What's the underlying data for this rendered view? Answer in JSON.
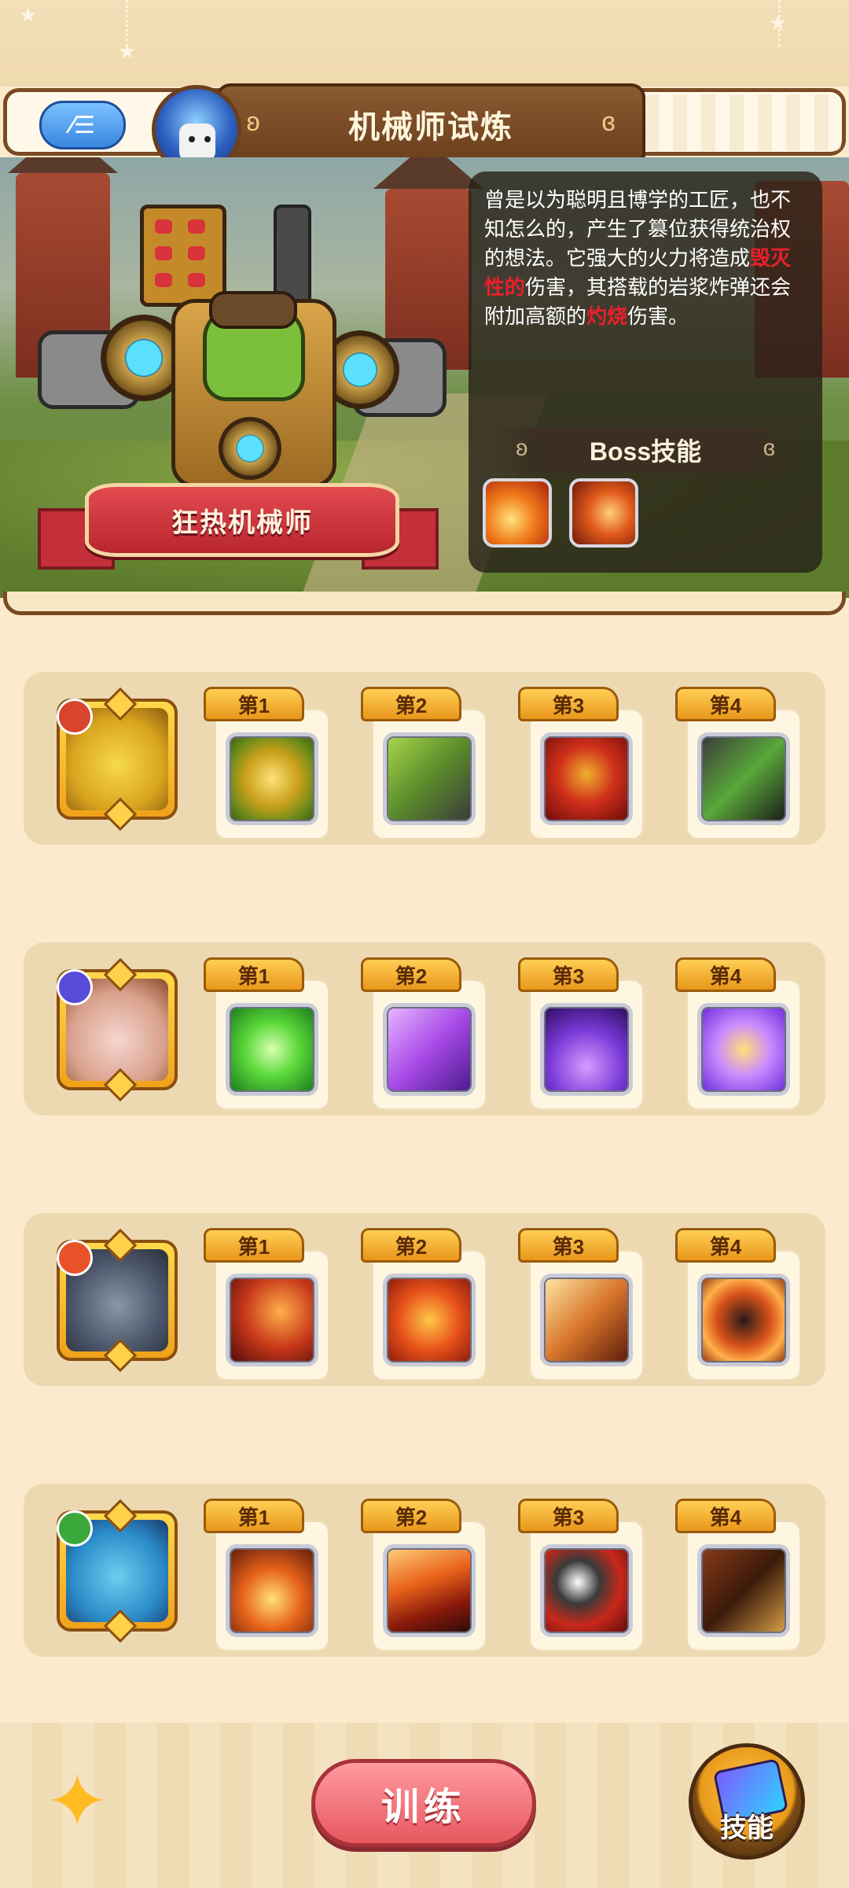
{
  "header": {
    "title": "机械师试炼",
    "back_label": "⁄☰"
  },
  "boss": {
    "name": "狂热机械师",
    "desc_a": "曾是以为聪明且博学的工匠，也不知怎么的，产生了篡位获得统治权的想法。它强大的火力将造成",
    "desc_hl1": "毁灭性的",
    "desc_b": "伤害，其搭载的岩浆炸弹还会附加高额的",
    "desc_hl2": "灼烧",
    "desc_c": "伤害。",
    "skills_title": "Boss技能",
    "skill_icons": [
      "flame-claw-icon",
      "fire-slash-icon"
    ]
  },
  "slot_labels": [
    "第1",
    "第2",
    "第3",
    "第4"
  ],
  "pets": [
    {
      "name": "yellow-pet-icon",
      "element": "fire-element-icon",
      "skills": [
        "golden-shield-icon",
        "thorn-attack-icon",
        "rage-face-icon",
        "dark-knight-icon"
      ]
    },
    {
      "name": "pink-king-pet-icon",
      "element": "water-element-icon",
      "skills": [
        "green-blast-icon",
        "purple-slash-icon",
        "spirit-sprout-icon",
        "angel-shield-icon"
      ]
    },
    {
      "name": "hippo-pet-icon",
      "element": "flame-element-icon",
      "skills": [
        "flame-beast-icon",
        "paw-strike-icon",
        "fire-tornado-icon",
        "dark-eruption-icon"
      ]
    },
    {
      "name": "blue-fish-pet-icon",
      "element": "wind-element-icon",
      "skills": [
        "campfire-icon",
        "claw-strike-icon",
        "meteor-hammer-icon",
        "bow-shot-icon"
      ]
    }
  ],
  "footer": {
    "train_label": "训练",
    "skill_label": "技能",
    "fish_icon": "fish-bone-icon"
  },
  "colors": {
    "highlight": "#e8202a",
    "accent": "#e8585f",
    "gold": "#f0a21a"
  }
}
